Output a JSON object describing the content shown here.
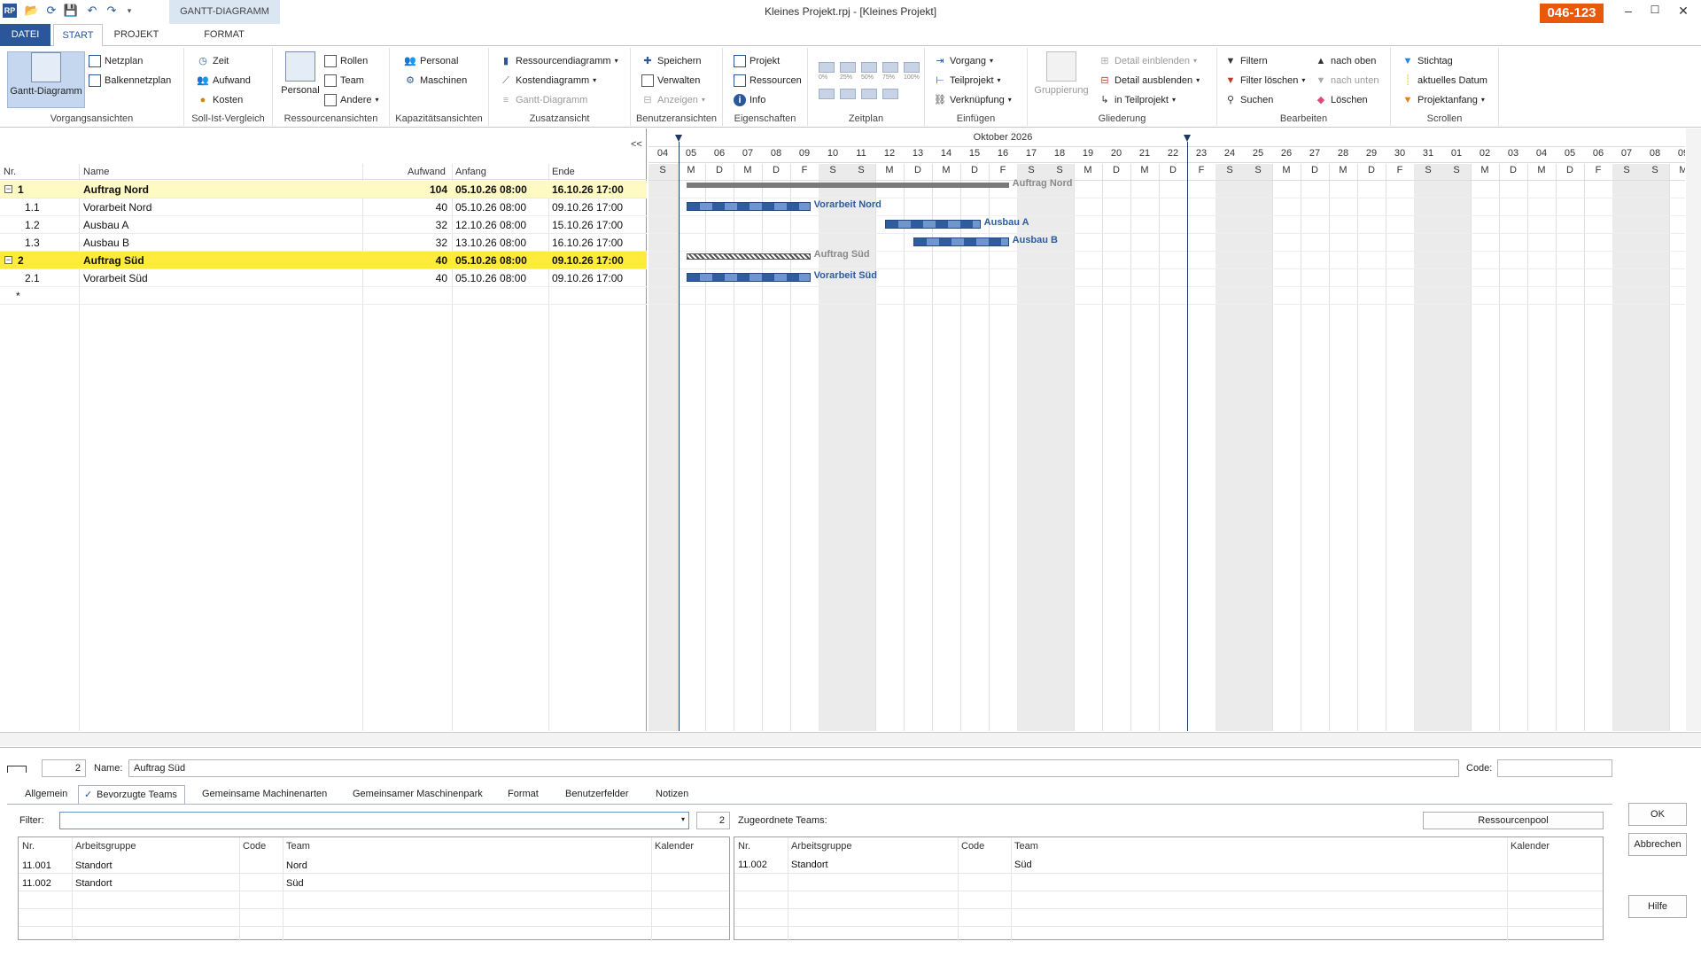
{
  "titlebar": {
    "title": "Kleines Projekt.rpj - [Kleines Projekt]",
    "license": "046-123",
    "context_tab": "GANTT-DIAGRAMM"
  },
  "tabs": {
    "datei": "DATEI",
    "start": "START",
    "projekt": "PROJEKT",
    "format": "FORMAT"
  },
  "ribbon": {
    "vorgangsansichten": {
      "label": "Vorgangsansichten",
      "gantt": "Gantt-Diagramm",
      "netzplan": "Netzplan",
      "balken": "Balkennetzplan"
    },
    "sollist": {
      "label": "Soll-Ist-Vergleich",
      "zeit": "Zeit",
      "aufwand": "Aufwand",
      "kosten": "Kosten"
    },
    "ressourcen": {
      "label": "Ressourcenansichten",
      "personal": "Personal",
      "rollen": "Rollen",
      "team": "Team",
      "andere": "Andere"
    },
    "kapazitaet": {
      "label": "Kapazitätsansichten",
      "personal": "Personal",
      "maschinen": "Maschinen"
    },
    "zusatz": {
      "label": "Zusatzansicht",
      "rdiag": "Ressourcendiagramm",
      "kdiag": "Kostendiagramm",
      "gantt": "Gantt-Diagramm"
    },
    "benutzer": {
      "label": "Benutzeransichten",
      "speichern": "Speichern",
      "verwalten": "Verwalten",
      "anzeigen": "Anzeigen"
    },
    "eigenschaften": {
      "label": "Eigenschaften",
      "projekt": "Projekt",
      "ressourcen": "Ressourcen",
      "info": "Info"
    },
    "zeitplan": {
      "label": "Zeitplan",
      "z0": "0%",
      "z25": "25%",
      "z50": "50%",
      "z75": "75%",
      "z100": "100%"
    },
    "einfuegen": {
      "label": "Einfügen",
      "vorgang": "Vorgang",
      "teilprojekt": "Teilprojekt",
      "verknuepfung": "Verknüpfung"
    },
    "gliederung": {
      "label": "Gliederung",
      "gruppierung": "Gruppierung",
      "einblenden": "Detail einblenden",
      "ausblenden": "Detail ausblenden",
      "teilprojekt": "in Teilprojekt"
    },
    "bearbeiten": {
      "label": "Bearbeiten",
      "filtern": "Filtern",
      "filter_loeschen": "Filter löschen",
      "suchen": "Suchen",
      "nach_oben": "nach oben",
      "nach_unten": "nach unten",
      "loeschen": "Löschen"
    },
    "scrollen": {
      "label": "Scrollen",
      "stichtag": "Stichtag",
      "aktuelles": "aktuelles Datum",
      "projektanfang": "Projektanfang"
    }
  },
  "table": {
    "collapse": "<<",
    "headers": {
      "nr": "Nr.",
      "name": "Name",
      "aufwand": "Aufwand",
      "anfang": "Anfang",
      "ende": "Ende"
    },
    "rows": [
      {
        "nr": "1",
        "name": "Auftrag Nord",
        "aufwand": "104",
        "anfang": "05.10.26 08:00",
        "ende": "16.10.26 17:00"
      },
      {
        "nr": "1.1",
        "name": "Vorarbeit Nord",
        "aufwand": "40",
        "anfang": "05.10.26 08:00",
        "ende": "09.10.26 17:00"
      },
      {
        "nr": "1.2",
        "name": "Ausbau A",
        "aufwand": "32",
        "anfang": "12.10.26 08:00",
        "ende": "15.10.26 17:00"
      },
      {
        "nr": "1.3",
        "name": "Ausbau B",
        "aufwand": "32",
        "anfang": "13.10.26 08:00",
        "ende": "16.10.26 17:00"
      },
      {
        "nr": "2",
        "name": "Auftrag Süd",
        "aufwand": "40",
        "anfang": "05.10.26 08:00",
        "ende": "09.10.26 17:00"
      },
      {
        "nr": "2.1",
        "name": "Vorarbeit Süd",
        "aufwand": "40",
        "anfang": "05.10.26 08:00",
        "ende": "09.10.26 17:00"
      }
    ],
    "new_row": "*"
  },
  "gantt": {
    "month": "Oktober 2026",
    "days": [
      "04",
      "05",
      "06",
      "07",
      "08",
      "09",
      "10",
      "11",
      "12",
      "13",
      "14",
      "15",
      "16",
      "17",
      "18",
      "19",
      "20",
      "21",
      "22",
      "23",
      "24",
      "25",
      "26",
      "27",
      "28",
      "29",
      "30",
      "31",
      "01",
      "02",
      "03",
      "04",
      "05",
      "06",
      "07",
      "08",
      "09"
    ],
    "weekdays": [
      "S",
      "M",
      "D",
      "M",
      "D",
      "F",
      "S",
      "S",
      "M",
      "D",
      "M",
      "D",
      "F",
      "S",
      "S",
      "M",
      "D",
      "M",
      "D",
      "F",
      "S",
      "S",
      "M",
      "D",
      "M",
      "D",
      "F",
      "S",
      "S",
      "M",
      "D",
      "M",
      "D",
      "F",
      "S",
      "S",
      "M"
    ],
    "bar_labels": {
      "auftrag_nord": "Auftrag Nord",
      "vorarbeit_nord": "Vorarbeit Nord",
      "ausbau_a": "Ausbau A",
      "ausbau_b": "Ausbau B",
      "auftrag_sued": "Auftrag Süd",
      "vorarbeit_sued": "Vorarbeit Süd"
    },
    "colors": {
      "bar": "#2e5c9e",
      "summary": "#7a7a7a",
      "weekend": "#ebebeb",
      "selected_row": "#ffeb3b"
    }
  },
  "detail": {
    "id": "2",
    "name_label": "Name:",
    "name_value": "Auftrag Süd",
    "code_label": "Code:",
    "code_value": "",
    "tabs": [
      "Allgemein",
      "Bevorzugte Teams",
      "Gemeinsame Machinenarten",
      "Gemeinsamer Maschinenpark",
      "Format",
      "Benutzerfelder",
      "Notizen"
    ],
    "filter_label": "Filter:",
    "filter_value": "",
    "count": "2",
    "assigned_label": "Zugeordnete Teams:",
    "pool_button": "Ressourcenpool",
    "left_headers": {
      "nr": "Nr.",
      "gruppe": "Arbeitsgruppe",
      "code": "Code",
      "team": "Team",
      "kalender": "Kalender"
    },
    "left_rows": [
      {
        "nr": "11.001",
        "gruppe": "Standort",
        "code": "",
        "team": "Nord"
      },
      {
        "nr": "11.002",
        "gruppe": "Standort",
        "code": "",
        "team": "Süd"
      }
    ],
    "right_headers": {
      "nr": "Nr.",
      "gruppe": "Arbeitsgruppe",
      "code": "Code",
      "team": "Team",
      "kalender": "Kalender"
    },
    "right_rows": [
      {
        "nr": "11.002",
        "gruppe": "Standort",
        "code": "",
        "team": "Süd"
      }
    ],
    "ok": "OK",
    "abbrechen": "Abbrechen",
    "hilfe": "Hilfe"
  }
}
